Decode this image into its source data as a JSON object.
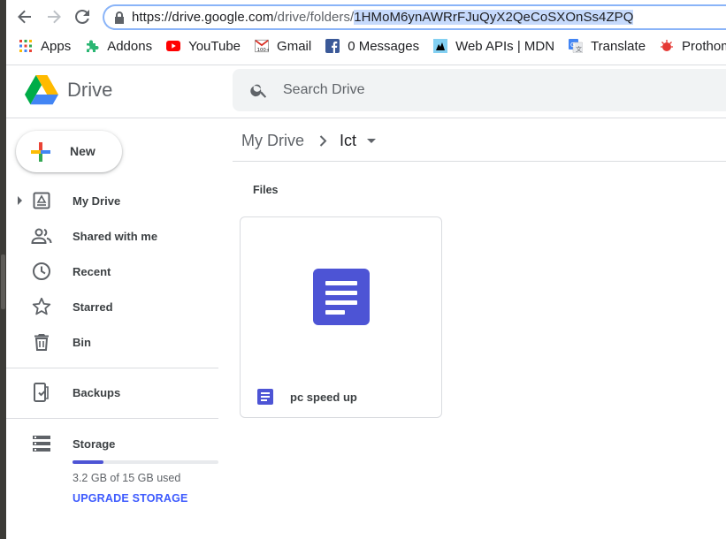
{
  "browser": {
    "url_host": "https://drive.google.com",
    "url_path": "/drive/folders/",
    "url_selected": "1HMoM6ynAWRrFJuQyX2QeCoSXOnSs4ZPQ",
    "bookmarks": [
      {
        "label": "Apps",
        "icon": "apps-grid-icon"
      },
      {
        "label": "Addons",
        "icon": "puzzle-icon"
      },
      {
        "label": "YouTube",
        "icon": "youtube-icon"
      },
      {
        "label": "Gmail",
        "icon": "gmail-icon"
      },
      {
        "label": "0 Messages",
        "icon": "facebook-icon"
      },
      {
        "label": "Web APIs | MDN",
        "icon": "mdn-icon"
      },
      {
        "label": "Translate",
        "icon": "translate-icon"
      },
      {
        "label": "Prothom",
        "icon": "prothom-icon"
      }
    ]
  },
  "header": {
    "app_name": "Drive",
    "search_placeholder": "Search Drive"
  },
  "sidebar": {
    "new_label": "New",
    "items": [
      {
        "label": "My Drive",
        "icon": "my-drive-icon"
      },
      {
        "label": "Shared with me",
        "icon": "shared-people-icon"
      },
      {
        "label": "Recent",
        "icon": "clock-icon"
      },
      {
        "label": "Starred",
        "icon": "star-icon"
      },
      {
        "label": "Bin",
        "icon": "trash-icon"
      },
      {
        "label": "Backups",
        "icon": "backup-device-icon"
      },
      {
        "label": "Storage",
        "icon": "storage-icon"
      }
    ],
    "storage_used_fraction": 0.21,
    "storage_text": "3.2 GB of 15 GB used",
    "upgrade_label": "UPGRADE STORAGE"
  },
  "main": {
    "breadcrumb_root": "My Drive",
    "breadcrumb_current": "Ict",
    "section_label": "Files",
    "files": [
      {
        "name": "pc speed up",
        "type": "google-doc"
      }
    ]
  },
  "colors": {
    "accent": "#4d54d5",
    "link": "#3d5afe",
    "omnibox_border": "#8ab4f8",
    "selection": "#c6dafc"
  }
}
